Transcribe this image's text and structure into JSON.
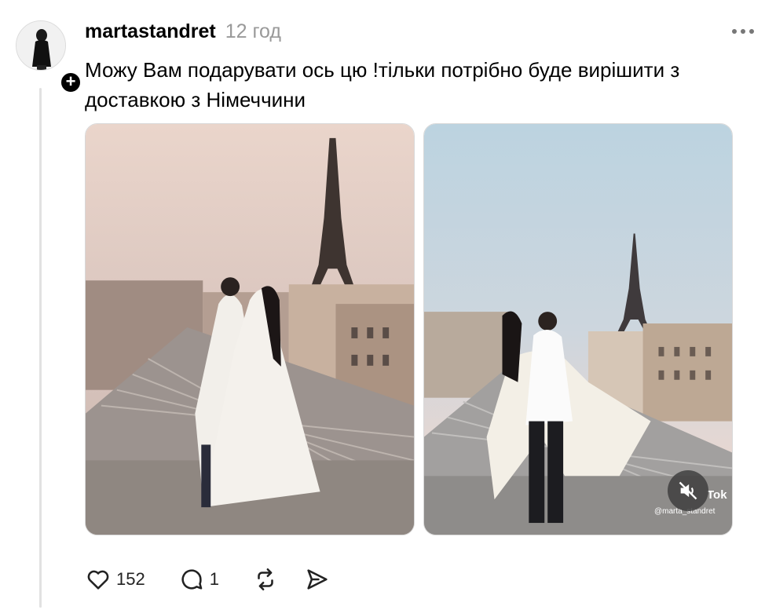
{
  "post": {
    "username": "martastandret",
    "timestamp": "12 год",
    "text": "Можу Вам подарувати ось цю !тільки потрібно буде вирішити з доставкою з Німеччини",
    "follow_symbol": "+"
  },
  "media": [
    {
      "type": "image",
      "icon": "photo-rooftop-eiffel"
    },
    {
      "type": "video",
      "icon": "video-rooftop-eiffel",
      "watermark": "Tok",
      "watermark_user": "@marta_standret",
      "mute_icon": "speaker-muted-icon"
    }
  ],
  "actions": {
    "like_count": "152",
    "comment_count": "1"
  },
  "colors": {
    "text": "#000000",
    "muted": "#999999",
    "thread_line": "#e1e1e1"
  }
}
